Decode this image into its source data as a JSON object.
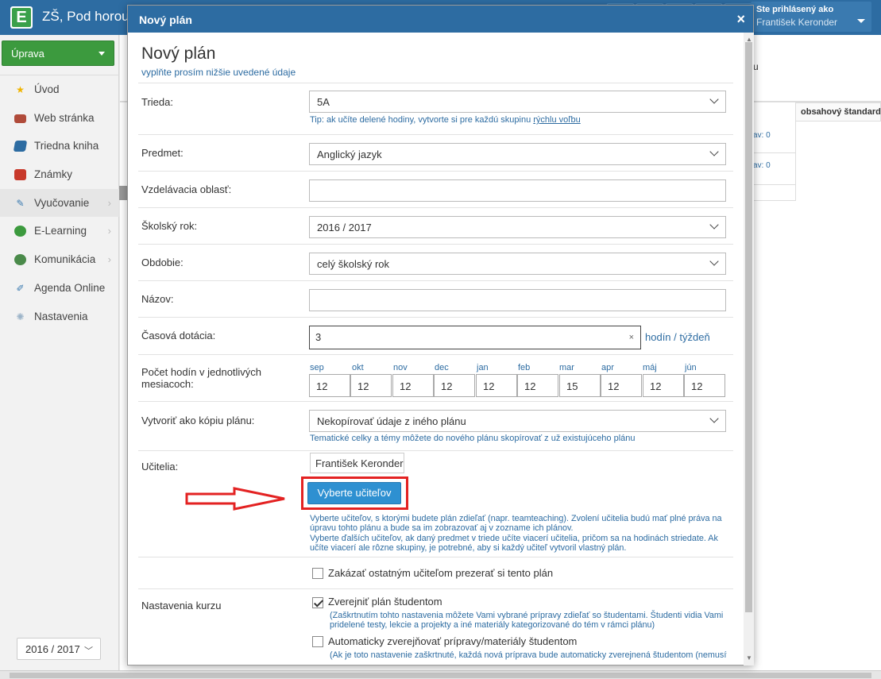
{
  "app": {
    "school_name": "ZŠ, Pod horou",
    "logo_letter": "E"
  },
  "user": {
    "logged_label": "Ste prihlásený ako",
    "name": "František Keronder"
  },
  "sidebar": {
    "edit_button": "Úprava",
    "items": [
      {
        "label": "Úvod",
        "icon": "star-icon"
      },
      {
        "label": "Web stránka",
        "icon": "house-icon"
      },
      {
        "label": "Triedna kniha",
        "icon": "book-icon"
      },
      {
        "label": "Známky",
        "icon": "grades-icon"
      },
      {
        "label": "Vyučovanie",
        "icon": "teaching-icon",
        "arrow": "›"
      },
      {
        "label": "E-Learning",
        "icon": "elearning-icon",
        "arrow": "›"
      },
      {
        "label": "Komunikácia",
        "icon": "communication-icon",
        "arrow": "›"
      },
      {
        "label": "Agenda Online",
        "icon": "pen-icon"
      },
      {
        "label": "Nastavenia",
        "icon": "gear-icon"
      }
    ],
    "year_select": "2016 / 2017"
  },
  "background": {
    "u_text": "u",
    "column_header": "obsahový štandard",
    "cell_1": "av: 0",
    "cell_2": "av: 0"
  },
  "modal": {
    "titlebar": "Nový plán",
    "close": "×",
    "heading": "Nový plán",
    "subheading": "vyplňte prosím nižšie uvedené údaje",
    "class_label": "Trieda:",
    "class_value": "5A",
    "class_hint_prefix": "Tip: ak učíte delené hodiny, vytvorte si pre každú skupinu ",
    "class_hint_link": "rýchlu voľbu",
    "subject_label": "Predmet:",
    "subject_value": "Anglický jazyk",
    "area_label": "Vzdelávacia oblasť:",
    "area_value": "",
    "year_label": "Školský rok:",
    "year_value": "2016 / 2017",
    "period_label": "Obdobie:",
    "period_value": "celý školský rok",
    "name_label": "Názov:",
    "name_value": "",
    "time_label": "Časová dotácia:",
    "time_value": "3",
    "time_clear": "×",
    "time_unit": "hodín / týždeň",
    "months_label": "Počet hodín v jednotlivých mesiacoch:",
    "months": [
      {
        "name": "sep",
        "value": "12"
      },
      {
        "name": "okt",
        "value": "12"
      },
      {
        "name": "nov",
        "value": "12"
      },
      {
        "name": "dec",
        "value": "12"
      },
      {
        "name": "jan",
        "value": "12"
      },
      {
        "name": "feb",
        "value": "12"
      },
      {
        "name": "mar",
        "value": "15"
      },
      {
        "name": "apr",
        "value": "12"
      },
      {
        "name": "máj",
        "value": "12"
      },
      {
        "name": "jún",
        "value": "12"
      }
    ],
    "copy_label": "Vytvoriť ako kópiu plánu:",
    "copy_value": "Nekopírovať údaje z iného plánu",
    "copy_hint": "Tematické celky a témy môžete do nového plánu skopírovať z už existujúceho plánu",
    "teachers_label": "Učitelia:",
    "teacher_chip": "František Keronder",
    "pick_teachers_button": "Vyberte učiteľov",
    "teachers_desc_1": "Vyberte učiteľov, s ktorými budete plán zdieľať (napr. teamteaching). Zvolení učitelia budú mať plné práva na úpravu tohto plánu a bude sa im zobrazovať aj v zozname ich plánov.",
    "teachers_desc_2": "Vyberte ďalších učiteľov, ak daný predmet v triede učíte viacerí učitelia, pričom sa na hodinách striedate. Ak učíte viacerí ale rôzne skupiny, je potrebné, aby si každý učiteľ vytvoril vlastný plán.",
    "forbid_label": "Zakázať ostatným učiteľom prezerať si tento plán",
    "course_label": "Nastavenia kurzu",
    "publish_label": "Zverejniť plán študentom",
    "publish_desc": "(Zaškrtnutím tohto nastavenia môžete Vami vybrané prípravy zdieľať so študentami. Študenti vidia Vami pridelené testy, lekcie a projekty a iné materiály kategorizované do tém v rámci plánu)",
    "auto_publish_label": "Automaticky zverejňovať prípravy/materiály študentom",
    "auto_publish_desc": "(Ak je toto nastavenie zaškrtnuté, každá nová príprava bude automaticky zverejnená študentom (nemusíte"
  },
  "colors": {
    "header_blue": "#2d6ca2",
    "accent_green": "#3c9a3e",
    "button_blue": "#2e90d1",
    "highlight_red": "#e32222"
  }
}
